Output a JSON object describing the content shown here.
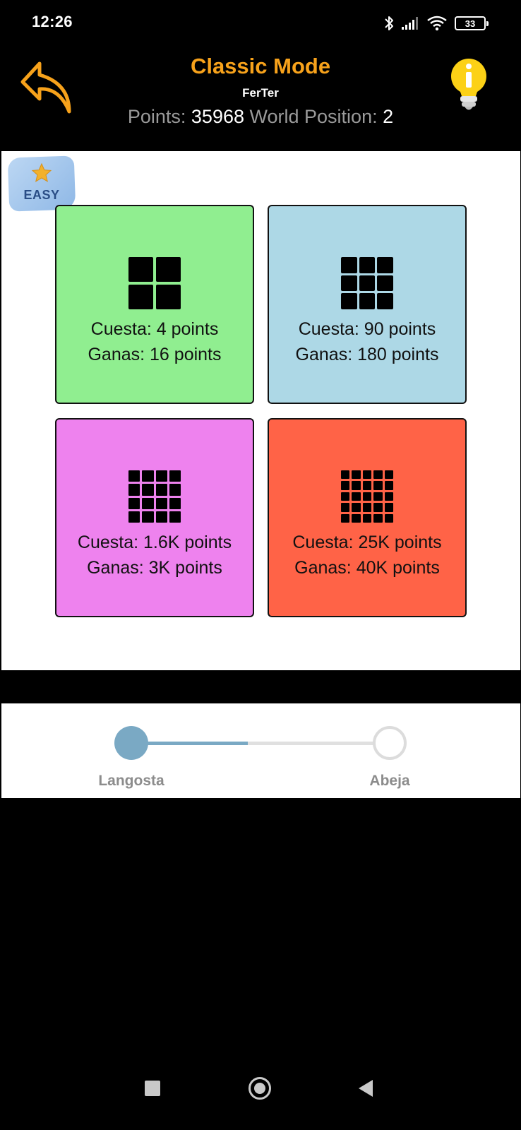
{
  "status_bar": {
    "time": "12:26",
    "battery": "33",
    "icons": [
      "bluetooth-icon",
      "signal-icon",
      "wifi-icon",
      "battery-icon"
    ]
  },
  "header": {
    "title": "Classic Mode",
    "username": "FerTer",
    "points_label": "Points:",
    "points_value": "35968",
    "world_label": "World Position:",
    "world_value": "2",
    "title_color": "#f7a21b",
    "back_icon": "back-arrow-icon",
    "info_icon": "lightbulb-info-icon"
  },
  "difficulty": {
    "label": "EASY",
    "icon": "star-icon"
  },
  "cards": [
    {
      "grid": 2,
      "cost": "Cuesta: 4 points",
      "reward": "Ganas: 16 points",
      "color": "#90ee90"
    },
    {
      "grid": 3,
      "cost": "Cuesta: 90 points",
      "reward": "Ganas: 180 points",
      "color": "#add8e6"
    },
    {
      "grid": 4,
      "cost": "Cuesta: 1.6K points",
      "reward": "Ganas: 3K points",
      "color": "#ee82ee"
    },
    {
      "grid": 5,
      "cost": "Cuesta: 25K points",
      "reward": "Ganas: 40K points",
      "color": "#ff6347"
    }
  ],
  "progress": {
    "start_label": "Langosta",
    "end_label": "Abeja",
    "fraction": 0.45,
    "fill_color": "#7aa9c4",
    "track_color": "#e0e0e0"
  },
  "navbar": {
    "icons": [
      "recents-icon",
      "home-icon",
      "back-icon"
    ]
  }
}
